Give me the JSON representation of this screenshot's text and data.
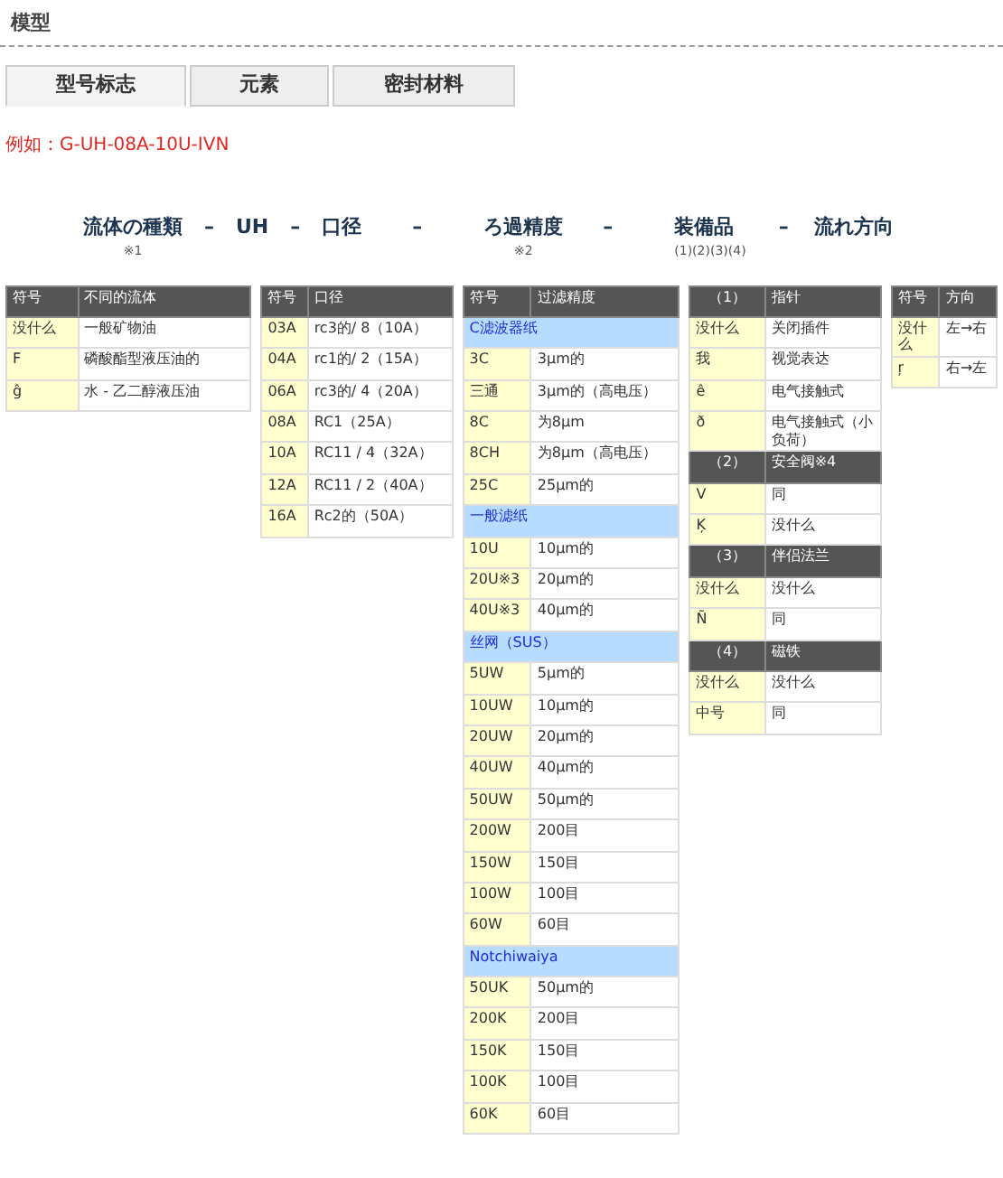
{
  "title": "模型",
  "tabs": [
    {
      "label": "型号标志",
      "selected": true
    },
    {
      "label": "元素",
      "selected": false
    },
    {
      "label": "密封材料",
      "selected": false
    }
  ],
  "example": "例如：G-UH-08A-10U-IVN",
  "code_parts": [
    {
      "kind": "term",
      "text": "流体の種類",
      "note": "※1"
    },
    {
      "kind": "dash",
      "text": "–"
    },
    {
      "kind": "term",
      "text": "UH"
    },
    {
      "kind": "dash",
      "text": "–"
    },
    {
      "kind": "term",
      "text": "口径"
    },
    {
      "kind": "dash",
      "text": "–"
    },
    {
      "kind": "term",
      "text": "ろ過精度",
      "note": "※2"
    },
    {
      "kind": "dash",
      "text": "–"
    },
    {
      "kind": "term",
      "text": "装備品",
      "note": "(1)(2)(3)(4)"
    },
    {
      "kind": "dash",
      "text": "–"
    },
    {
      "kind": "term",
      "text": "流れ方向"
    }
  ],
  "tables": [
    {
      "rows": [
        {
          "kind": "header",
          "cells": [
            "符号",
            "不同的流体"
          ]
        },
        {
          "kind": "row",
          "cells": [
            "没什么",
            "一般矿物油"
          ]
        },
        {
          "kind": "row",
          "cells": [
            "F",
            "磷酸酯型液压油的"
          ]
        },
        {
          "kind": "row",
          "cells": [
            "ĝ",
            "水 - 乙二醇液压油"
          ]
        }
      ]
    },
    {
      "rows": [
        {
          "kind": "header",
          "cells": [
            "符号",
            "口径"
          ]
        },
        {
          "kind": "row",
          "cells": [
            "03A",
            "rc3的/ 8（10A）"
          ]
        },
        {
          "kind": "row",
          "cells": [
            "04A",
            "rc1的/ 2（15A）"
          ]
        },
        {
          "kind": "row",
          "cells": [
            "06A",
            "rc3的/ 4（20A）"
          ]
        },
        {
          "kind": "row",
          "cells": [
            "08A",
            "RC1（25A）"
          ]
        },
        {
          "kind": "row",
          "cells": [
            "10A",
            "RC11 / 4（32A）"
          ]
        },
        {
          "kind": "row",
          "cells": [
            "12A",
            "RC11 / 2（40A）"
          ]
        },
        {
          "kind": "row",
          "cells": [
            "16A",
            "Rc2的（50A）"
          ]
        }
      ]
    },
    {
      "rows": [
        {
          "kind": "header",
          "cells": [
            "符号",
            "过滤精度"
          ]
        },
        {
          "kind": "section",
          "text": "C滤波器纸"
        },
        {
          "kind": "row",
          "cells": [
            "3C",
            "3μm的"
          ]
        },
        {
          "kind": "row",
          "cells": [
            "三通",
            "3μm的（高电压）"
          ]
        },
        {
          "kind": "row",
          "cells": [
            "8C",
            "为8μm"
          ]
        },
        {
          "kind": "row",
          "cells": [
            "8CH",
            "为8μm（高电压）"
          ]
        },
        {
          "kind": "row",
          "cells": [
            "25C",
            "25μm的"
          ]
        },
        {
          "kind": "section",
          "text": "一般滤纸"
        },
        {
          "kind": "row",
          "cells": [
            "10U",
            "10μm的"
          ]
        },
        {
          "kind": "row",
          "cells": [
            "20U※3",
            "20μm的"
          ]
        },
        {
          "kind": "row",
          "cells": [
            "40U※3",
            "40μm的"
          ]
        },
        {
          "kind": "section",
          "text": "丝网（SUS）"
        },
        {
          "kind": "row",
          "cells": [
            "5UW",
            "5μm的"
          ]
        },
        {
          "kind": "row",
          "cells": [
            "10UW",
            "10μm的"
          ]
        },
        {
          "kind": "row",
          "cells": [
            "20UW",
            "20μm的"
          ]
        },
        {
          "kind": "row",
          "cells": [
            "40UW",
            "40μm的"
          ]
        },
        {
          "kind": "row",
          "cells": [
            "50UW",
            "50μm的"
          ]
        },
        {
          "kind": "row",
          "cells": [
            "200W",
            "200目"
          ]
        },
        {
          "kind": "row",
          "cells": [
            "150W",
            "150目"
          ]
        },
        {
          "kind": "row",
          "cells": [
            "100W",
            "100目"
          ]
        },
        {
          "kind": "row",
          "cells": [
            "60W",
            "60目"
          ]
        },
        {
          "kind": "section",
          "text": "Notchiwaiya"
        },
        {
          "kind": "row",
          "cells": [
            "50UK",
            "50μm的"
          ]
        },
        {
          "kind": "row",
          "cells": [
            "200K",
            "200目"
          ]
        },
        {
          "kind": "row",
          "cells": [
            "150K",
            "150目"
          ]
        },
        {
          "kind": "row",
          "cells": [
            "100K",
            "100目"
          ]
        },
        {
          "kind": "row",
          "cells": [
            "60K",
            "60目"
          ]
        }
      ]
    },
    {
      "rows": [
        {
          "kind": "header",
          "cells": [
            "（1）",
            "指针"
          ]
        },
        {
          "kind": "row",
          "cells": [
            "没什么",
            "关闭插件"
          ]
        },
        {
          "kind": "row",
          "cells": [
            "我",
            "视觉表达"
          ]
        },
        {
          "kind": "row",
          "cells": [
            "ê",
            "电气接触式"
          ]
        },
        {
          "kind": "row",
          "cells": [
            "ð",
            "电气接触式（小负荷）"
          ]
        },
        {
          "kind": "header",
          "cells": [
            "（2）",
            "安全阀※4"
          ]
        },
        {
          "kind": "row",
          "cells": [
            "V",
            "同"
          ]
        },
        {
          "kind": "row",
          "cells": [
            "Ķ",
            "没什么"
          ]
        },
        {
          "kind": "header",
          "cells": [
            "（3）",
            "伴侣法兰"
          ]
        },
        {
          "kind": "row",
          "cells": [
            "没什么",
            "没什么"
          ]
        },
        {
          "kind": "row",
          "cells": [
            "Ñ",
            "同"
          ]
        },
        {
          "kind": "header",
          "cells": [
            "（4）",
            "磁铁"
          ]
        },
        {
          "kind": "row",
          "cells": [
            "没什么",
            "没什么"
          ]
        },
        {
          "kind": "row",
          "cells": [
            "中号",
            "同"
          ]
        }
      ]
    },
    {
      "rows": [
        {
          "kind": "header",
          "cells": [
            "符号",
            "方向"
          ]
        },
        {
          "kind": "row",
          "cells": [
            "没什么",
            "左→右"
          ]
        },
        {
          "kind": "row",
          "cells": [
            "ŗ",
            "右→左"
          ]
        }
      ]
    }
  ]
}
